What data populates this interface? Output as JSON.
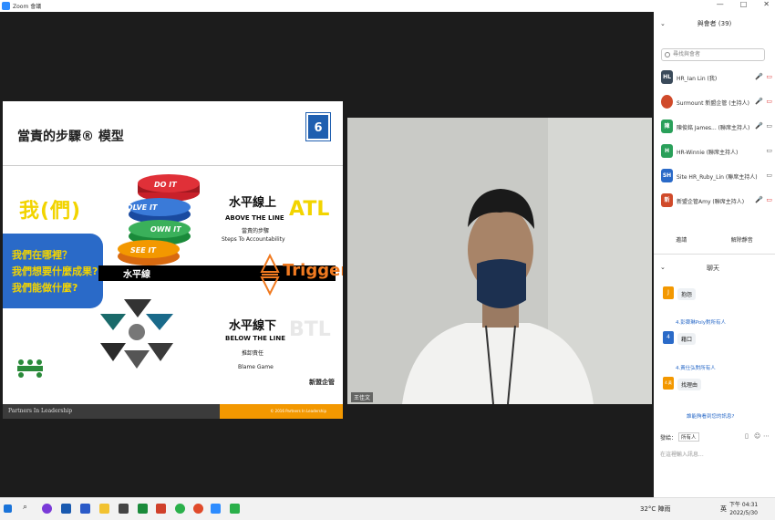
{
  "window": {
    "title": "Zoom 會議",
    "controls": [
      "—",
      "□",
      "✕"
    ]
  },
  "slide": {
    "title": "當責的步驟® 模型",
    "number": "6",
    "we": "我(們)",
    "questions": [
      "我們在哪裡？",
      "我們想要什麼成果?",
      "我們能做什麼?"
    ],
    "steps": [
      "DO IT",
      "SOLVE IT",
      "OWN IT",
      "SEE IT"
    ],
    "horizon": "水平線",
    "atl_cn": "水平線上",
    "atl_en": "ABOVE THE LINE",
    "atl_sub1": "當責的步驟",
    "atl_sub2": "Steps To Accountability",
    "atl": "ATL",
    "trigger": "Trigger",
    "btl_cn": "水平線下",
    "btl_en": "BELOW THE LINE",
    "btl_sub1": "推卸責任",
    "btl_sub2": "Blame Game",
    "btl": "BTL",
    "footer": "Partners In Leadership",
    "footer_copy": "© 2016 Partners In Leadership",
    "brand": "新盟企管"
  },
  "video": {
    "name": "王佳文"
  },
  "participants": {
    "title": "與會者 (39)",
    "search_placeholder": "尋找與會者",
    "list": [
      {
        "initials": "HL",
        "name": "HR_Ian Lin (我)",
        "color": "#3a4a5a"
      },
      {
        "initials": "",
        "name": "Surmount 新盟企管 (主持人)",
        "color": "#d04a2a"
      },
      {
        "initials": "陳",
        "name": "陳俊銘 James... (聯席主持人)",
        "color": "#2aa05a"
      },
      {
        "initials": "H",
        "name": "HR-Winnie (聯席主持人)",
        "color": "#2aa05a"
      },
      {
        "initials": "SH",
        "name": "Site HR_Ruby_Lin (聯席主持人)",
        "color": "#2a6ac8"
      },
      {
        "initials": "新",
        "name": "新盟企管Amy (聯席主持人)",
        "color": "#d04a2a"
      }
    ],
    "buttons": [
      "邀請",
      "解除靜音"
    ]
  },
  "chat": {
    "title": "聊天",
    "messages": [
      {
        "avatar": "J",
        "color": "#f39800",
        "sender": "",
        "text": "抱怨"
      },
      {
        "avatar": "4",
        "color": "#2a6ac8",
        "sender": "4.彭霽琳Poly對所有人",
        "text": "藉口"
      },
      {
        "avatar": "4.黃",
        "color": "#f39800",
        "sender": "4.黃仕弘對所有人",
        "text": "找理由"
      }
    ],
    "who_can_see": "誰能夠看到您的訊息?",
    "send_label": "發給：",
    "send_to": "所有人",
    "input_placeholder": "在這裡輸入訊息..."
  },
  "taskbar": {
    "weather": "32°C 陣雨",
    "time": "下午 04:31",
    "date": "2022/5/30",
    "lang": "英"
  }
}
